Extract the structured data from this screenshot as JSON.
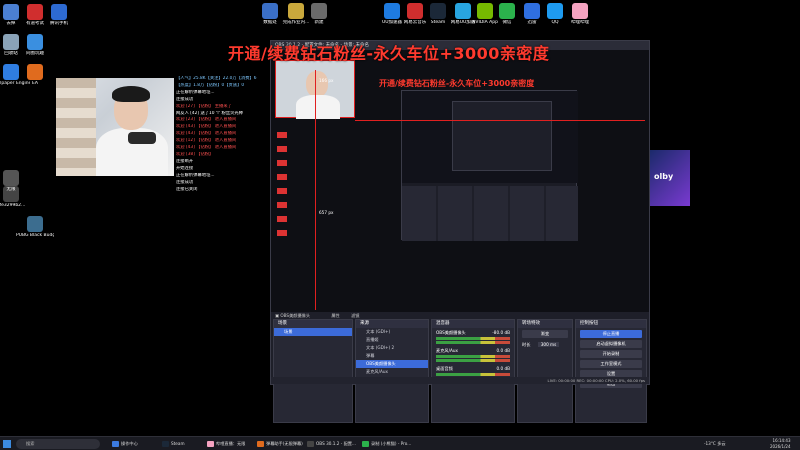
{
  "banner": "开通/续费钻石粉丝-永久车位+3000亲密度",
  "desktop_icons_left": [
    {
      "label": "去掉",
      "color": "#4b7fd1"
    },
    {
      "label": "有道考试",
      "color": "#d02e2e"
    },
    {
      "label": "腾讯手机",
      "color": "#2d6ad1"
    },
    {
      "label": "回收站",
      "color": "#8aa3b8"
    },
    {
      "label": "同图玩趣",
      "color": "#3a8fe0"
    },
    {
      "label": "Wallpaper Engine",
      "color": "#2f7de1"
    },
    {
      "label": "EA",
      "color": "#e06b1e"
    },
    {
      "label": "7fe3299b2...",
      "color": "#444"
    },
    {
      "label": "PUBG Black Budget Pl...",
      "color": "#3c6d8f"
    },
    {
      "label": "无限",
      "color": "#555"
    }
  ],
  "desktop_icons_top": [
    {
      "label": "数据处",
      "color": "#3a6fc7"
    },
    {
      "label": "完成作业内...",
      "color": "#c9a83c"
    },
    {
      "label": "新建",
      "color": "#6b6b6b"
    },
    {
      "label": "UU加速器",
      "color": "#1e7be0"
    },
    {
      "label": "网易云音乐",
      "color": "#d02e2e"
    },
    {
      "label": "Steam",
      "color": "#1b2838"
    },
    {
      "label": "网易UU加速",
      "color": "#28a5e0"
    },
    {
      "label": "NVIDIA App",
      "color": "#76b900"
    },
    {
      "label": "微信",
      "color": "#2bb24c"
    },
    {
      "label": "迅雷",
      "color": "#2f6fe0"
    },
    {
      "label": "QQ",
      "color": "#1e9bf0"
    },
    {
      "label": "哔哩哔哩",
      "color": "#f5a3c1"
    }
  ],
  "chat": {
    "stats": "【人气】25.8K【关注】22.0万【消费】6",
    "stats2": "【热度】1.8万【钻粉】0【贵族】0",
    "lines": [
      {
        "text": "正在解析弹幕地址...",
        "color": "#ffffff"
      },
      {
        "text": "连接成功",
        "color": "#ffffff"
      },
      {
        "text": "欢迎 [27] 【钻粉】 主播来了",
        "color": "#ff5050"
      },
      {
        "text": "网友人 [42] 送了10 个 粉丝荧光棒",
        "color": "#ffffff"
      },
      {
        "text": "欢迎 [23] 【钻粉】 进入直播间",
        "color": "#ff5050"
      },
      {
        "text": "欢迎 [43] 【钻粉】 进入直播间",
        "color": "#ff5050"
      },
      {
        "text": "欢迎 [43] 【钻粉】 进入直播间",
        "color": "#ff5050"
      },
      {
        "text": "欢迎 [12] 【钻粉】 进入直播间",
        "color": "#ff5050"
      },
      {
        "text": "欢迎 [43] 【钻粉】 进入直播间",
        "color": "#ff5050"
      },
      {
        "text": "欢迎 [38] 【钻粉】",
        "color": "#ff5050"
      },
      {
        "text": "连接断开",
        "color": "#ffffff"
      },
      {
        "text": "开始连接",
        "color": "#ffffff"
      },
      {
        "text": "正在解析弹幕地址...",
        "color": "#ffffff"
      },
      {
        "text": "连接成功",
        "color": "#ffffff"
      },
      {
        "text": "连接已关闭",
        "color": "#ffffff"
      }
    ]
  },
  "obs": {
    "title": "OBS 30.1.2 - 配置文件: 未命名 - 场景: 未命名",
    "nested_banner": "开通/续费钻石粉丝-永久车位+3000亲密度",
    "canvas_size_top": "166 px",
    "canvas_size_left": "657 px",
    "source_toolbar": {
      "label": "OBS美颜摄像头",
      "properties": "属性",
      "filters": "滤镜"
    },
    "scenes": {
      "title": "场景",
      "items": [
        "场景"
      ]
    },
    "sources": {
      "title": "来源",
      "items": [
        "文本 (GDI+)",
        "直播姬",
        "文本 (GDI+) 2",
        "弹幕",
        "OBS美颜摄像头",
        "麦克风/Aux",
        "显示器采集"
      ]
    },
    "mixer": {
      "title": "混音器",
      "channels": [
        {
          "name": "OBS美颜摄像头",
          "db": "-80.0 dB"
        },
        {
          "name": "麦克风/Aux",
          "db": "0.0 dB"
        },
        {
          "name": "桌面音频",
          "db": "0.0 dB"
        }
      ]
    },
    "transitions": {
      "title": "转场特效",
      "type": "渐变",
      "duration_label": "时长",
      "duration": "300 ms"
    },
    "controls": {
      "title": "控制按钮",
      "buttons": [
        "停止直播",
        "启动虚拟摄像机",
        "开始录制",
        "工作室模式",
        "设置",
        "退出"
      ]
    },
    "status": "LIVE: 00:00:00   REC: 00:00:00   CPU: 2.0%, 60.00 fps"
  },
  "taskbar": {
    "search": "搜索",
    "items": [
      {
        "label": "操作中心",
        "color": "#3c7be0"
      },
      {
        "label": "Steam",
        "color": "#1b2838"
      },
      {
        "label": "哔哩直播：无限",
        "color": "#f5a3c1"
      },
      {
        "label": "弹幕助手(无限弹幕)",
        "color": "#e06b1e"
      },
      {
        "label": "OBS 30.1.2 - 配置...",
        "color": "#444"
      },
      {
        "label": "录制 (小熊猫) - Pro...",
        "color": "#2bb24c"
      }
    ],
    "weather": "-13°C 多云",
    "time": "16:14:43",
    "date": "2026/1/24"
  }
}
